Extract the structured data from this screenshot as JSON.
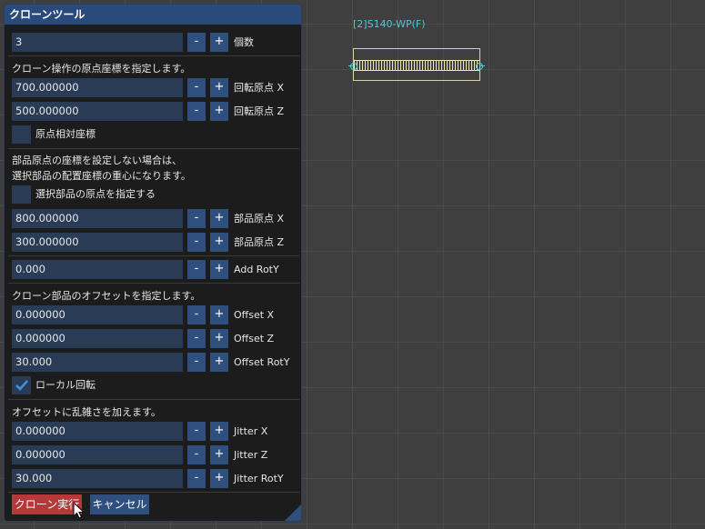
{
  "scene": {
    "label": "[2]S140-WP(F)"
  },
  "panel": {
    "title": "クローンツール",
    "count": {
      "value": "3",
      "label": "個数"
    },
    "origin_section_text": "クローン操作の原点座標を指定します。",
    "rot_origin_x": {
      "value": "700.000000",
      "label": "回転原点 X"
    },
    "rot_origin_z": {
      "value": "500.000000",
      "label": "回転原点 Z"
    },
    "relative_coords": {
      "label": "原点相対座標",
      "checked": false
    },
    "part_origin_text_1": "部品原点の座標を設定しない場合は、",
    "part_origin_text_2": "選択部品の配置座標の重心になります。",
    "specify_part_origin": {
      "label": "選択部品の原点を指定する",
      "checked": false
    },
    "part_origin_x": {
      "value": "800.000000",
      "label": "部品原点 X"
    },
    "part_origin_z": {
      "value": "300.000000",
      "label": "部品原点 Z"
    },
    "add_roty": {
      "value": "0.000",
      "label": "Add RotY"
    },
    "offset_section_text": "クローン部品のオフセットを指定します。",
    "offset_x": {
      "value": "0.000000",
      "label": "Offset X"
    },
    "offset_z": {
      "value": "0.000000",
      "label": "Offset Z"
    },
    "offset_roty": {
      "value": "30.000",
      "label": "Offset RotY"
    },
    "local_rotation": {
      "label": "ローカル回転",
      "checked": true
    },
    "jitter_section_text": "オフセットに乱雑さを加えます。",
    "jitter_x": {
      "value": "0.000000",
      "label": "Jitter X"
    },
    "jitter_z": {
      "value": "0.000000",
      "label": "Jitter Z"
    },
    "jitter_roty": {
      "value": "30.000",
      "label": "Jitter RotY"
    },
    "minus_label": "-",
    "plus_label": "+",
    "run_button": "クローン実行",
    "cancel_button": "キャンセル"
  },
  "colors": {
    "accent": "#2f4f7e",
    "danger": "#b8383a",
    "scene_text": "#4fc6d6"
  }
}
